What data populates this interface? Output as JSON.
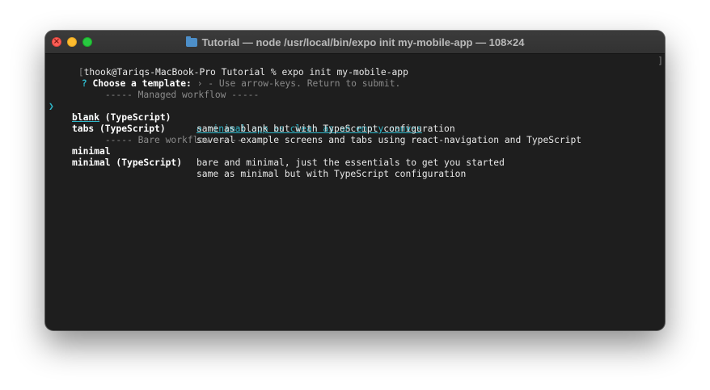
{
  "window": {
    "title": "Tutorial — node /usr/local/bin/expo init my-mobile-app — 108×24",
    "close_glyph": "×"
  },
  "terminal": {
    "command_prefix": "[",
    "command_line": "thook@Tariqs-MacBook-Pro Tutorial % expo init my-mobile-app",
    "right_bracket": "]",
    "question_mark": "?",
    "question_label": "Choose a template:",
    "question_hint": "› - Use arrow-keys. Return to submit.",
    "pointer": "❯",
    "managed_separator": "----- Managed workflow -----",
    "bare_separator": "----- Bare workflow -----",
    "templates": [
      {
        "name": "blank",
        "description": "a minimal app as clean as an empty canvas"
      },
      {
        "name": "blank (TypeScript)",
        "description": "same as blank but with TypeScript configuration"
      },
      {
        "name": "tabs (TypeScript)",
        "description": "several example screens and tabs using react-navigation and TypeScript"
      },
      {
        "name": "minimal",
        "description": "bare and minimal, just the essentials to get you started"
      },
      {
        "name": "minimal (TypeScript)",
        "description": "same as minimal but with TypeScript configuration"
      }
    ],
    "selected_template": "blank"
  },
  "colors": {
    "accent": "#2fb7c9",
    "background": "#1e1e1e",
    "titlebar": "#323232"
  }
}
